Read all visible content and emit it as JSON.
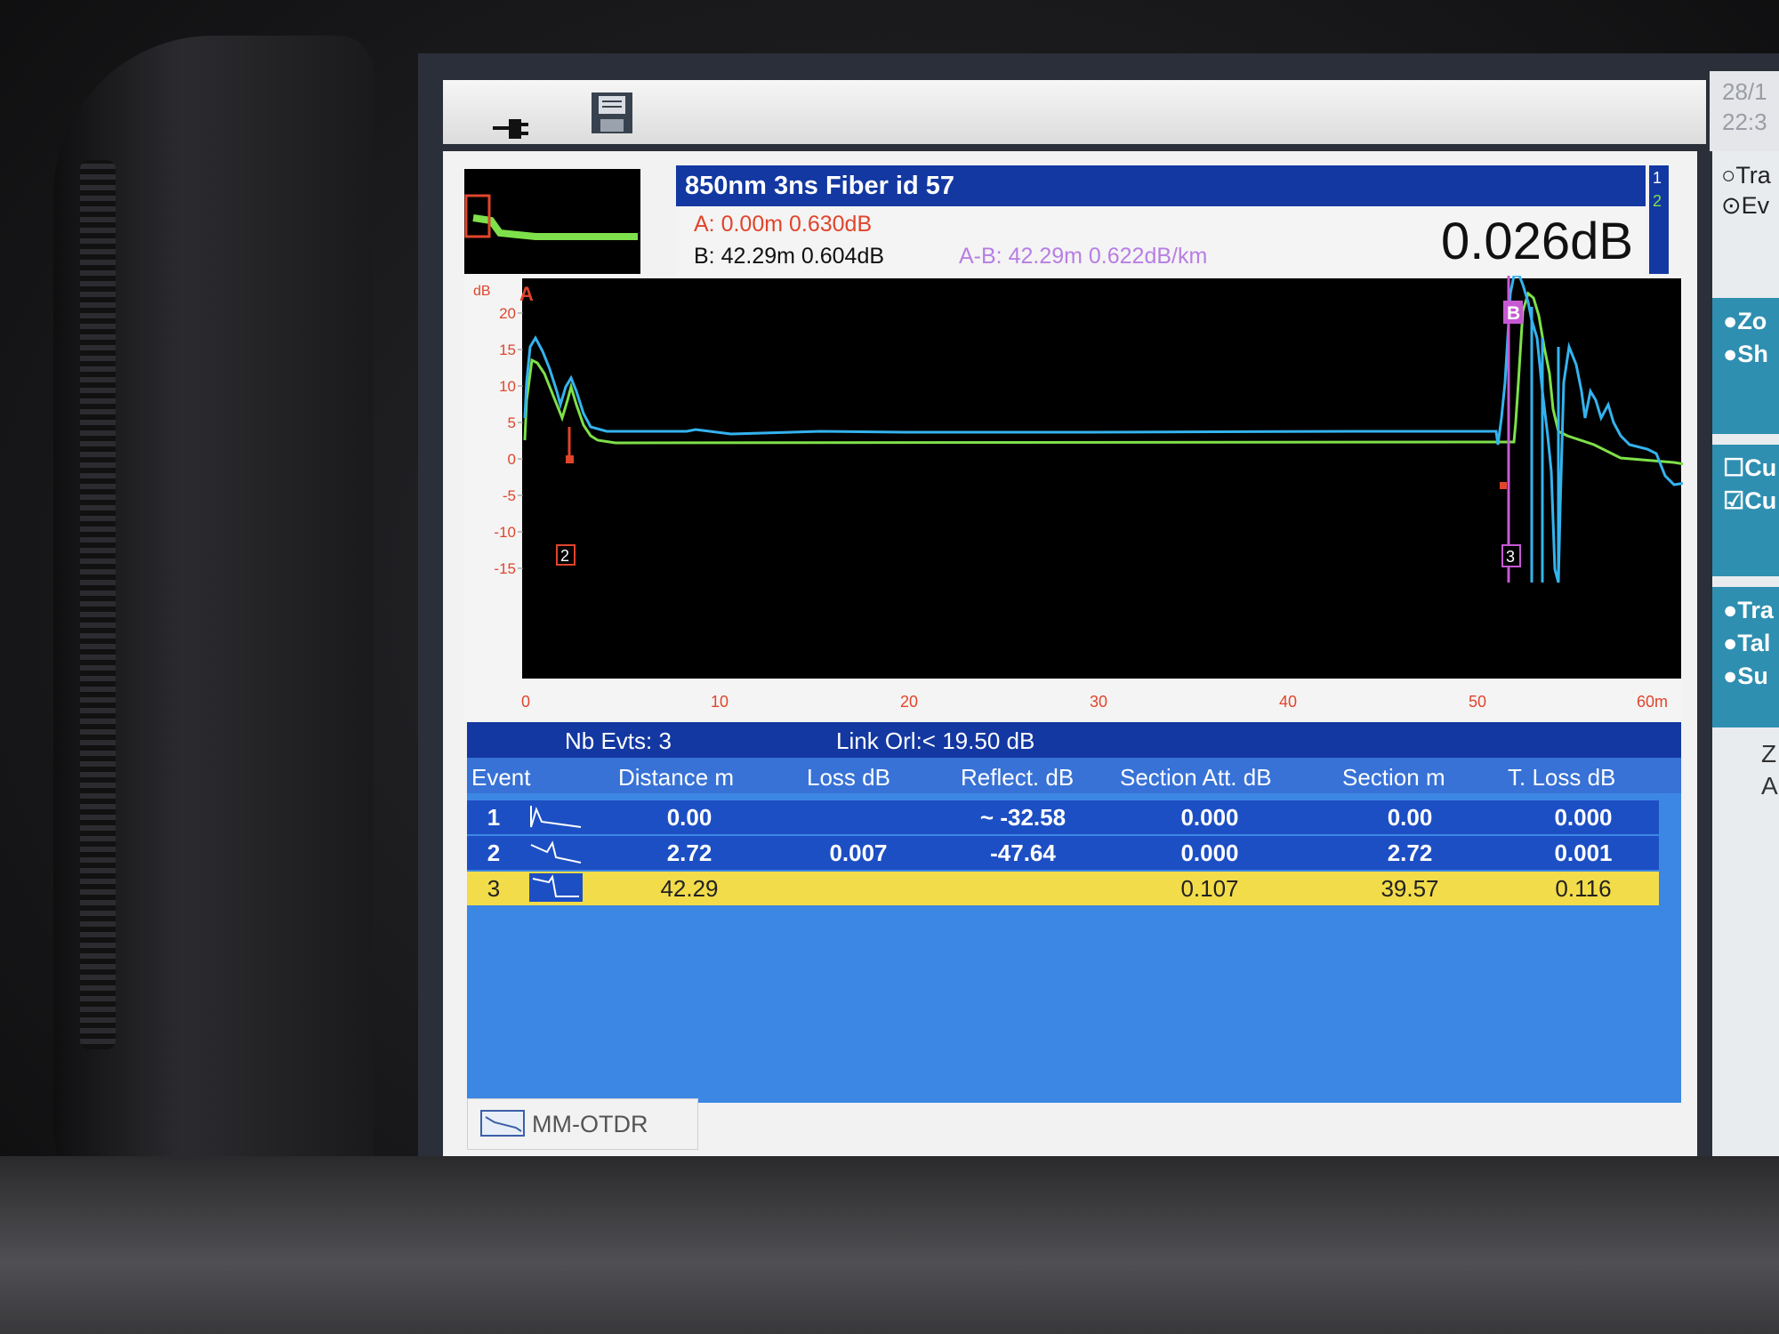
{
  "datetime": {
    "date": "28/1",
    "time": "22:3"
  },
  "header": {
    "title": "850nm  3ns   Fiber id  57",
    "cursor_a": "A: 0.00m  0.630dB",
    "cursor_b": "B: 42.29m  0.604dB",
    "cursor_ab": "A-B: 42.29m 0.622dB/km",
    "value": "0.026dB",
    "trace_selector": [
      "1",
      "2"
    ]
  },
  "right_panel": {
    "options_top": [
      "Tra",
      "Ev"
    ],
    "zoom_options": [
      "Zo",
      "Sh"
    ],
    "cursor_options": [
      "Cu",
      "Cu"
    ],
    "view_options": [
      "Tra",
      "Tal",
      "Su"
    ],
    "bottom_labels": [
      "Z",
      "A"
    ]
  },
  "chart": {
    "y_unit": "dB",
    "y_ticks": [
      "20",
      "15",
      "10",
      "5",
      "0",
      "-5",
      "-10",
      "-15"
    ],
    "x_ticks": [
      "0",
      "10",
      "20",
      "30",
      "40",
      "50",
      "60m"
    ],
    "marker_a": "A",
    "marker_b": "B",
    "event_marker_2": "2",
    "event_marker_3": "3",
    "colors": {
      "trace1": "#34b3ee",
      "trace2": "#7ee04a",
      "cursor_a": "#e0452c",
      "cursor_b": "#c659d3"
    }
  },
  "table": {
    "nb_events": "Nb Evts: 3",
    "link_orl": "Link Orl:< 19.50 dB",
    "columns": [
      "Event",
      "Distance  m",
      "Loss dB",
      "Reflect. dB",
      "Section Att. dB",
      "Section m",
      "T. Loss dB"
    ],
    "rows": [
      {
        "event": "1",
        "distance": "0.00",
        "loss": "",
        "reflect": "~ -32.58",
        "section_att": "0.000",
        "section": "0.00",
        "t_loss": "0.000"
      },
      {
        "event": "2",
        "distance": "2.72",
        "loss": "0.007",
        "reflect": "-47.64",
        "section_att": "0.000",
        "section": "2.72",
        "t_loss": "0.001"
      },
      {
        "event": "3",
        "distance": "42.29",
        "loss": "",
        "reflect": "",
        "section_att": "0.107",
        "section": "39.57",
        "t_loss": "0.116"
      }
    ]
  },
  "footer": {
    "tab_label": "MM-OTDR"
  }
}
